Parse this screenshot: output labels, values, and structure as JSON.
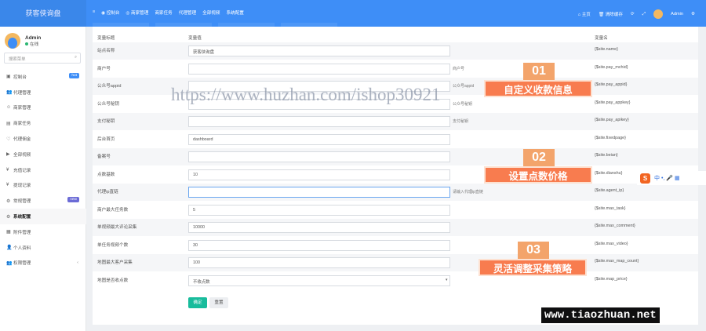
{
  "brand": "获客侠询盘",
  "topnav": {
    "menu_icon": "≡",
    "items": [
      {
        "icon": "tachometer-icon",
        "label": "控制台"
      },
      {
        "icon": "eye-icon",
        "label": "商家管理"
      },
      {
        "icon": "",
        "label": "商家任务"
      },
      {
        "icon": "",
        "label": "代理管理"
      },
      {
        "icon": "",
        "label": "全部视频"
      },
      {
        "icon": "",
        "label": "系统配置"
      }
    ],
    "right": [
      "主页",
      "清除缓存",
      "",
      ""
    ],
    "user": "Admin"
  },
  "sidebar": {
    "user": {
      "name": "Admin",
      "status": "在线"
    },
    "search_placeholder": "搜索菜单",
    "items": [
      {
        "icon": "▣",
        "label": "控制台",
        "badge": "hot",
        "badge_color": "#3e8ef7"
      },
      {
        "icon": "👥",
        "label": "代理管理"
      },
      {
        "icon": "☺",
        "label": "商家管理"
      },
      {
        "icon": "▤",
        "label": "商家任务"
      },
      {
        "icon": "♡",
        "label": "代理佣金"
      },
      {
        "icon": "▶",
        "label": "全部视频"
      },
      {
        "icon": "¥",
        "label": "充值记录"
      },
      {
        "icon": "¥",
        "label": "提现记录"
      },
      {
        "icon": "⚙",
        "label": "常规管理",
        "badge": "new",
        "badge_color": "#6b6bd6"
      },
      {
        "icon": "⚙",
        "label": "系统配置",
        "active": true
      },
      {
        "icon": "▦",
        "label": "附件管理"
      },
      {
        "icon": "👤",
        "label": "个人资料"
      },
      {
        "icon": "👥",
        "label": "权限管理",
        "chevron": "‹"
      }
    ]
  },
  "table": {
    "headers": {
      "title": "变量标题",
      "value": "变量值",
      "name": "变量名"
    },
    "rows": [
      {
        "title": "站点名称",
        "value": "获客侠询盘",
        "note": "",
        "var": "{$site.name}"
      },
      {
        "title": "商户号",
        "value": "",
        "note": "商户号",
        "var": "{$site.pay_mchid}"
      },
      {
        "title": "公众号appid",
        "value": "",
        "note": "公众号appid",
        "var": "{$site.pay_appid}"
      },
      {
        "title": "公众号秘钥",
        "value": "",
        "note": "公众号秘钥",
        "var": "{$site.pay_appkey}"
      },
      {
        "title": "支付秘钥",
        "value": "",
        "note": "支付秘钥",
        "var": "{$site.pay_apikey}"
      },
      {
        "title": "后台首页",
        "value": "dashboard",
        "note": "",
        "var": "{$site.fixedpage}"
      },
      {
        "title": "备案号",
        "value": "",
        "note": "",
        "var": "{$site.beian}"
      },
      {
        "title": "点数基数",
        "value": "10",
        "note": "",
        "var": "{$site.dianshu}"
      },
      {
        "title": "代理ip直链",
        "value": "",
        "note": "请输入代理ip直链",
        "var": "{$site.agent_ip}",
        "focus": true
      },
      {
        "title": "商户最大任务数",
        "value": "5",
        "note": "",
        "var": "{$site.max_task}"
      },
      {
        "title": "单视频最大评论采集",
        "value": "10000",
        "note": "",
        "var": "{$site.max_comment}"
      },
      {
        "title": "单任务视频个数",
        "value": "30",
        "note": "",
        "var": "{$site.max_video}"
      },
      {
        "title": "地图最大客户采集",
        "value": "100",
        "note": "",
        "var": "{$site.max_map_count}"
      },
      {
        "title": "地图是否收点数",
        "value": "不收点数",
        "note": "",
        "var": "{$site.map_price}",
        "select": true
      }
    ]
  },
  "buttons": {
    "confirm": "确定",
    "reset": "重置",
    "confirm_color": "#18bc9c"
  },
  "watermark": "https://www.huzhan.com/ishop30921",
  "callouts": [
    {
      "num": "01",
      "label": "自定义收款信息"
    },
    {
      "num": "02",
      "label": "设置点数价格"
    },
    {
      "num": "03",
      "label": "灵活调整采集策略"
    }
  ],
  "ime": {
    "logo": "S",
    "text": "中 •, 🎤 ▦"
  },
  "footer_watermark": "www.tiaozhuan.net"
}
